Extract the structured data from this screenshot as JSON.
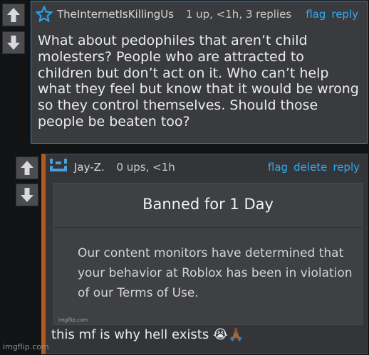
{
  "comment1": {
    "username": "TheInternetIsKillingUs",
    "stats": "1 up, <1h, 3 replies",
    "actions": {
      "flag": "flag",
      "reply": "reply"
    },
    "body": "What about pedophiles that aren’t child molesters? People who are attracted to children but don’t act on it. Who can’t help what they feel but know that it would be wrong so they control themselves. Should those people be beaten too?"
  },
  "comment2": {
    "username": "Jay-Z.",
    "stats": "0 ups, <1h",
    "actions": {
      "flag": "flag",
      "delete": "delete",
      "reply": "reply"
    },
    "embed": {
      "title": "Banned for 1 Day",
      "message": "Our content monitors have determined that your behavior at Roblox has been in violation of our Terms of Use.",
      "watermark": "imgflip.com"
    },
    "body": "this mf is why hell exists 😭🙏🏾"
  },
  "watermark": "imgflip.com",
  "colors": {
    "link": "#33a8f0",
    "highlight_border": "#3f7fa8",
    "reply_bar": "#b35a1f",
    "star": "#29a3ef",
    "avatar": "#4aa0d6"
  }
}
